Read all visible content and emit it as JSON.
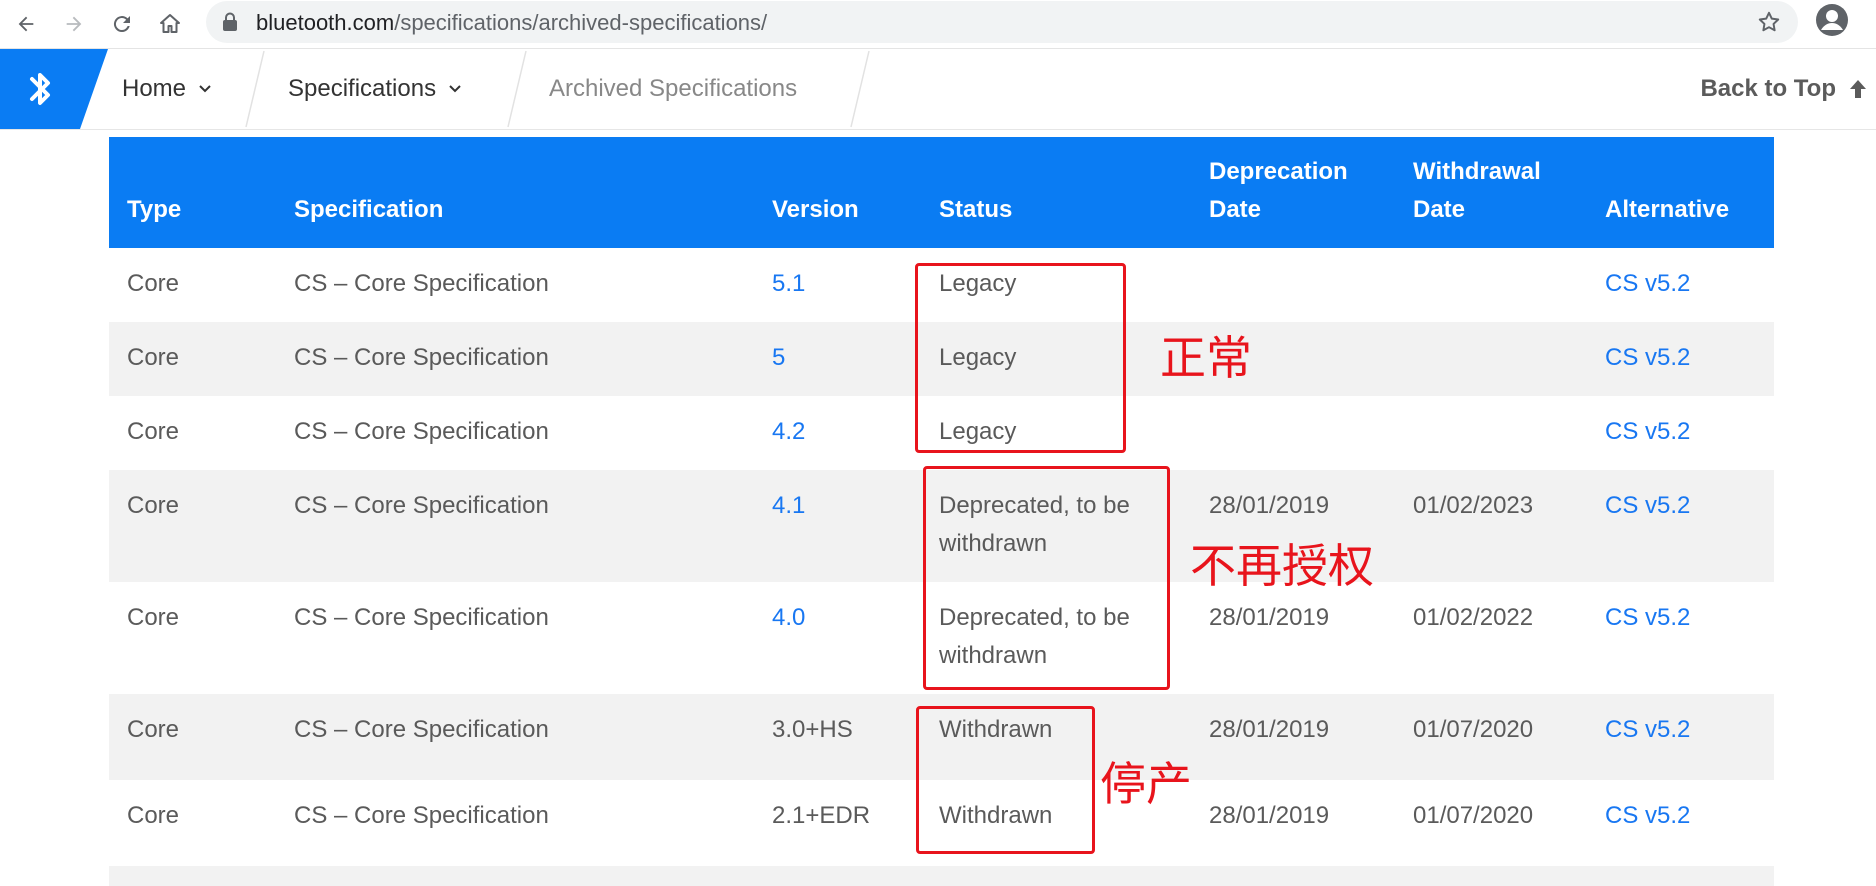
{
  "browser": {
    "url_host": "bluetooth.com",
    "url_path": "/specifications/archived-specifications/"
  },
  "header": {
    "menu": [
      {
        "label": "Home"
      },
      {
        "label": "Specifications"
      },
      {
        "label": "Archived Specifications"
      }
    ],
    "back_to_top": "Back to Top"
  },
  "table": {
    "columns": {
      "type": "Type",
      "specification": "Specification",
      "version": "Version",
      "status": "Status",
      "deprecation_1": "Deprecation",
      "deprecation_2": "Date",
      "withdrawal_1": "Withdrawal",
      "withdrawal_2": "Date",
      "alternative": "Alternative"
    },
    "rows": [
      {
        "type": "Core",
        "spec": "CS – Core Specification",
        "version": "5.1",
        "status": "Legacy",
        "deprecation": "",
        "withdrawal": "",
        "alternative": "CS v5.2"
      },
      {
        "type": "Core",
        "spec": "CS – Core Specification",
        "version": "5",
        "status": "Legacy",
        "deprecation": "",
        "withdrawal": "",
        "alternative": "CS v5.2"
      },
      {
        "type": "Core",
        "spec": "CS – Core Specification",
        "version": "4.2",
        "status": "Legacy",
        "deprecation": "",
        "withdrawal": "",
        "alternative": "CS v5.2"
      },
      {
        "type": "Core",
        "spec": "CS – Core Specification",
        "version": "4.1",
        "status_1": "Deprecated, to be",
        "status_2": "withdrawn",
        "deprecation": "28/01/2019",
        "withdrawal": "01/02/2023",
        "alternative": "CS v5.2"
      },
      {
        "type": "Core",
        "spec": "CS – Core Specification",
        "version": "4.0",
        "status_1": "Deprecated, to be",
        "status_2": "withdrawn",
        "deprecation": "28/01/2019",
        "withdrawal": "01/02/2022",
        "alternative": "CS v5.2"
      },
      {
        "type": "Core",
        "spec": "CS – Core Specification",
        "version": "3.0+HS",
        "status": "Withdrawn",
        "deprecation": "28/01/2019",
        "withdrawal": "01/07/2020",
        "alternative": "CS v5.2"
      },
      {
        "type": "Core",
        "spec": "CS – Core Specification",
        "version": "2.1+EDR",
        "status": "Withdrawn",
        "deprecation": "28/01/2019",
        "withdrawal": "01/07/2020",
        "alternative": "CS v5.2"
      }
    ]
  },
  "annotations": {
    "normal": "正常",
    "deauthorized": "不再授权",
    "discontinued": "停产",
    "color": "#e8141c"
  },
  "colors": {
    "brand_blue": "#0a7cf3",
    "link_blue": "#1877f2"
  }
}
